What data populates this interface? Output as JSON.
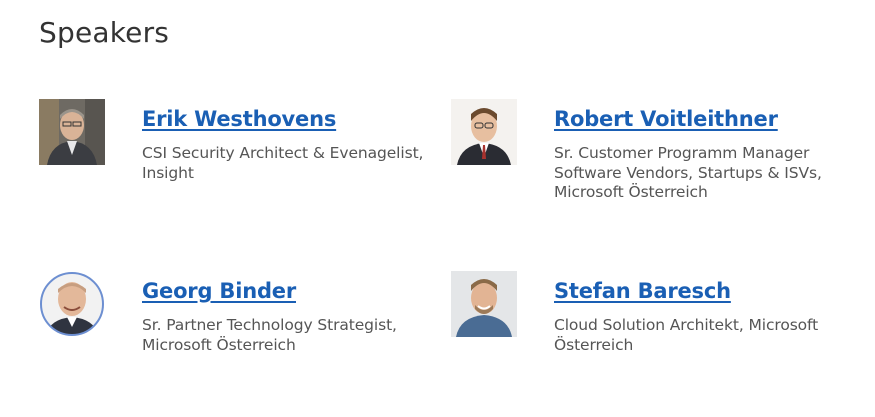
{
  "section": {
    "title": "Speakers"
  },
  "speakers": [
    {
      "name": "Erik Westhovens",
      "role": "CSI Security Architect & Evenagelist, Insight"
    },
    {
      "name": "Robert Voitleithner",
      "role": "Sr. Customer Programm Manager Software Vendors, Startups & ISVs, Microsoft Österreich"
    },
    {
      "name": "Georg Binder",
      "role": "Sr. Partner Technology Strategist, Microsoft Österreich"
    },
    {
      "name": "Stefan Baresch",
      "role": "Cloud Solution Architekt, Microsoft Österreich"
    }
  ],
  "colors": {
    "link": "#1a5fb4",
    "text": "#555555",
    "heading": "#333333"
  }
}
